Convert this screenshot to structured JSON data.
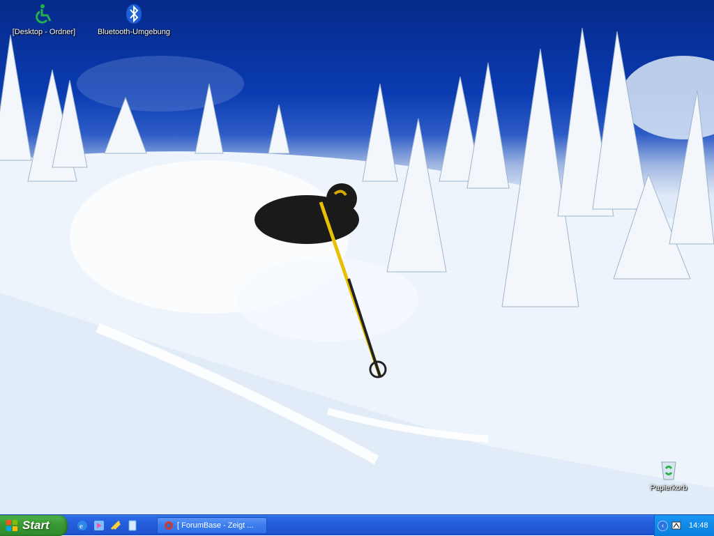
{
  "desktop": {
    "icons": [
      {
        "label": "[Desktop - Ordner]",
        "icon": "accessibility-icon"
      },
      {
        "label": "Bluetooth-Umgebung",
        "icon": "bluetooth-icon"
      },
      {
        "label": "Papierkorb",
        "icon": "recycle-bin-icon"
      }
    ]
  },
  "taskbar": {
    "start_label": "Start",
    "quick_launch": [
      "internet-explorer-icon",
      "media-player-icon",
      "launch-icon",
      "show-desktop-icon"
    ],
    "task_button": {
      "label": "[ ForumBase - Zeigt ...",
      "icon": "browser-icon"
    },
    "tray": {
      "clock": "14:48",
      "icons": [
        "expand-tray-icon",
        "network-icon"
      ]
    }
  }
}
